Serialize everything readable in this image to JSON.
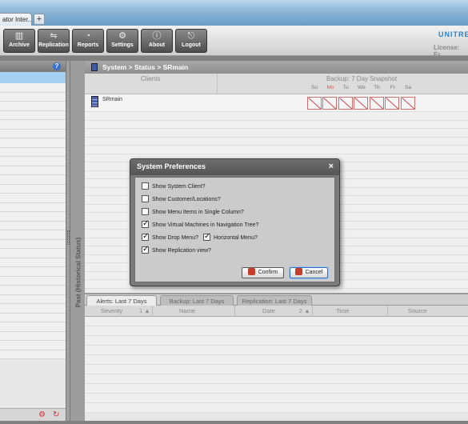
{
  "browser": {
    "tab_title": "ator Inter...",
    "tab_close": "×",
    "new_tab": "+"
  },
  "toolbar": {
    "buttons": [
      {
        "label": "Archive",
        "icon": "archive-icon"
      },
      {
        "label": "Replication",
        "icon": "replication-icon"
      },
      {
        "label": "Reports",
        "icon": "reports-icon"
      },
      {
        "label": "Settings",
        "icon": "settings-icon"
      },
      {
        "label": "About",
        "icon": "about-icon"
      },
      {
        "label": "Logout",
        "icon": "logout-icon"
      }
    ],
    "brand": "UNITRE",
    "license": "License: Er"
  },
  "sidebar": {
    "help": "?"
  },
  "main": {
    "breadcrumb": "System  >  Status  >  SRmain",
    "clients_header": "Clients",
    "snapshot_header": "Backup: 7 Day Snapshot",
    "days": [
      "Su",
      "Mo",
      "Tu",
      "We",
      "Th",
      "Fr",
      "Sa"
    ],
    "client": "SRmain"
  },
  "historical_label": "Past (Historical Status)",
  "bottom": {
    "tabs": [
      "Alerts: Last 7 Days",
      "Backup: Last 7 Days",
      "Replication: Last 7 Days"
    ],
    "columns": [
      "Severity",
      "1 ▲",
      "Name",
      "Date",
      "2 ▲",
      "Time",
      "Source"
    ]
  },
  "modal": {
    "title": "System Preferences",
    "close": "×",
    "options": [
      {
        "label": "Show System Client?",
        "checked": false
      },
      {
        "label": "Show Customer/Locations?",
        "checked": false
      },
      {
        "label": "Show Menu Items in Single Column?",
        "checked": false
      },
      {
        "label": "Show Virtual Machines in Navigation Tree?",
        "checked": true
      },
      {
        "label": "Show Drop Menu?",
        "checked": true
      },
      {
        "label": "Horizontal Menu?",
        "checked": true
      },
      {
        "label": "Show Replication view?",
        "checked": true
      }
    ],
    "confirm": "Confirm",
    "cancel": "Cancel"
  },
  "colors": {
    "accent": "#2d7fc6",
    "selected": "#a6d0f2",
    "error": "#d04848"
  }
}
